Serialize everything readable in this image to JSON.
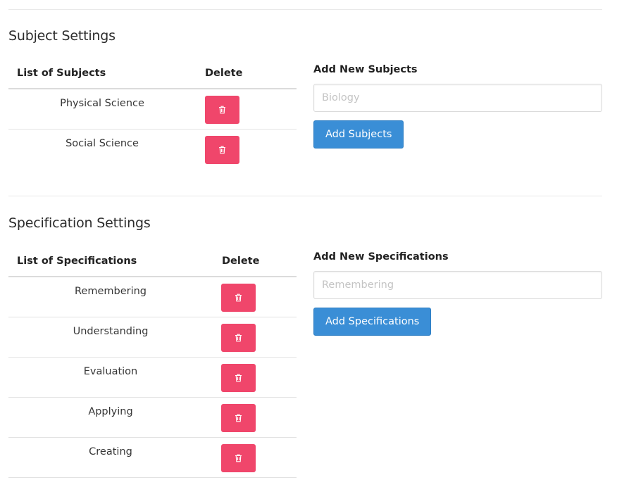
{
  "subjects": {
    "title": "Subject Settings",
    "table": {
      "col_name": "List of Subjects",
      "col_delete": "Delete",
      "rows": [
        {
          "name": "Physical Science"
        },
        {
          "name": "Social Science"
        }
      ]
    },
    "form": {
      "label": "Add New Subjects",
      "placeholder": "Biology",
      "value": "",
      "button": "Add Subjects"
    }
  },
  "specifications": {
    "title": "Specification Settings",
    "table": {
      "col_name": "List of Specifications",
      "col_delete": "Delete",
      "rows": [
        {
          "name": "Remembering"
        },
        {
          "name": "Understanding"
        },
        {
          "name": "Evaluation"
        },
        {
          "name": "Applying"
        },
        {
          "name": "Creating"
        }
      ]
    },
    "form": {
      "label": "Add New Specifications",
      "placeholder": "Remembering",
      "value": "",
      "button": "Add Specifications"
    }
  },
  "colors": {
    "delete_button": "#f0466b",
    "primary_button": "#3a8ed6"
  },
  "icons": {
    "delete": "trash-icon"
  }
}
